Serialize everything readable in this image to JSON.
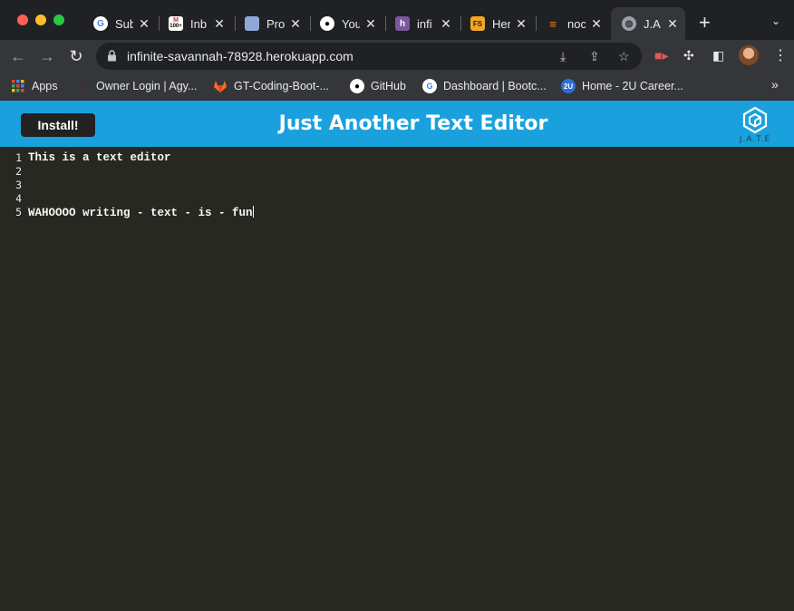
{
  "browser": {
    "tabs": [
      {
        "title": "Sub",
        "icon": "google-icon",
        "active": false
      },
      {
        "title": "Inb",
        "icon": "gmail-icon",
        "badge": "100+",
        "active": false
      },
      {
        "title": "Pro",
        "icon": "project-icon",
        "active": false
      },
      {
        "title": "You",
        "icon": "github-icon",
        "active": false
      },
      {
        "title": "infi",
        "icon": "heroku-icon",
        "active": false
      },
      {
        "title": "Her",
        "icon": "fs-icon",
        "active": false
      },
      {
        "title": "noc",
        "icon": "stackoverflow-icon",
        "active": false
      },
      {
        "title": "J.A",
        "icon": "globe-icon",
        "active": true
      }
    ],
    "new_tab_label": "+",
    "url": "infinite-savannah-78928.herokuapp.com",
    "bookmarks": [
      {
        "label": "Apps",
        "icon": "apps-grid-icon"
      },
      {
        "label": "Owner Login | Agy...",
        "icon": "agy-icon"
      },
      {
        "label": "GT-Coding-Boot-...",
        "icon": "gitlab-icon"
      },
      {
        "label": "GitHub",
        "icon": "github-icon"
      },
      {
        "label": "Dashboard | Bootc...",
        "icon": "google-icon"
      },
      {
        "label": "Home - 2U Career...",
        "icon": "2u-icon"
      }
    ],
    "bookmarks_more": "»"
  },
  "app": {
    "install_label": "Install!",
    "title": "Just Another Text Editor",
    "logo_text": "J.A.T.E",
    "brand_color": "#1aa1dd"
  },
  "editor": {
    "lines": [
      {
        "num": "1",
        "text": "This is a text editor"
      },
      {
        "num": "2",
        "text": ""
      },
      {
        "num": "3",
        "text": ""
      },
      {
        "num": "4",
        "text": ""
      },
      {
        "num": "5",
        "text": "WAHOOOO writing - text - is - fun"
      }
    ],
    "background": "#272822"
  }
}
